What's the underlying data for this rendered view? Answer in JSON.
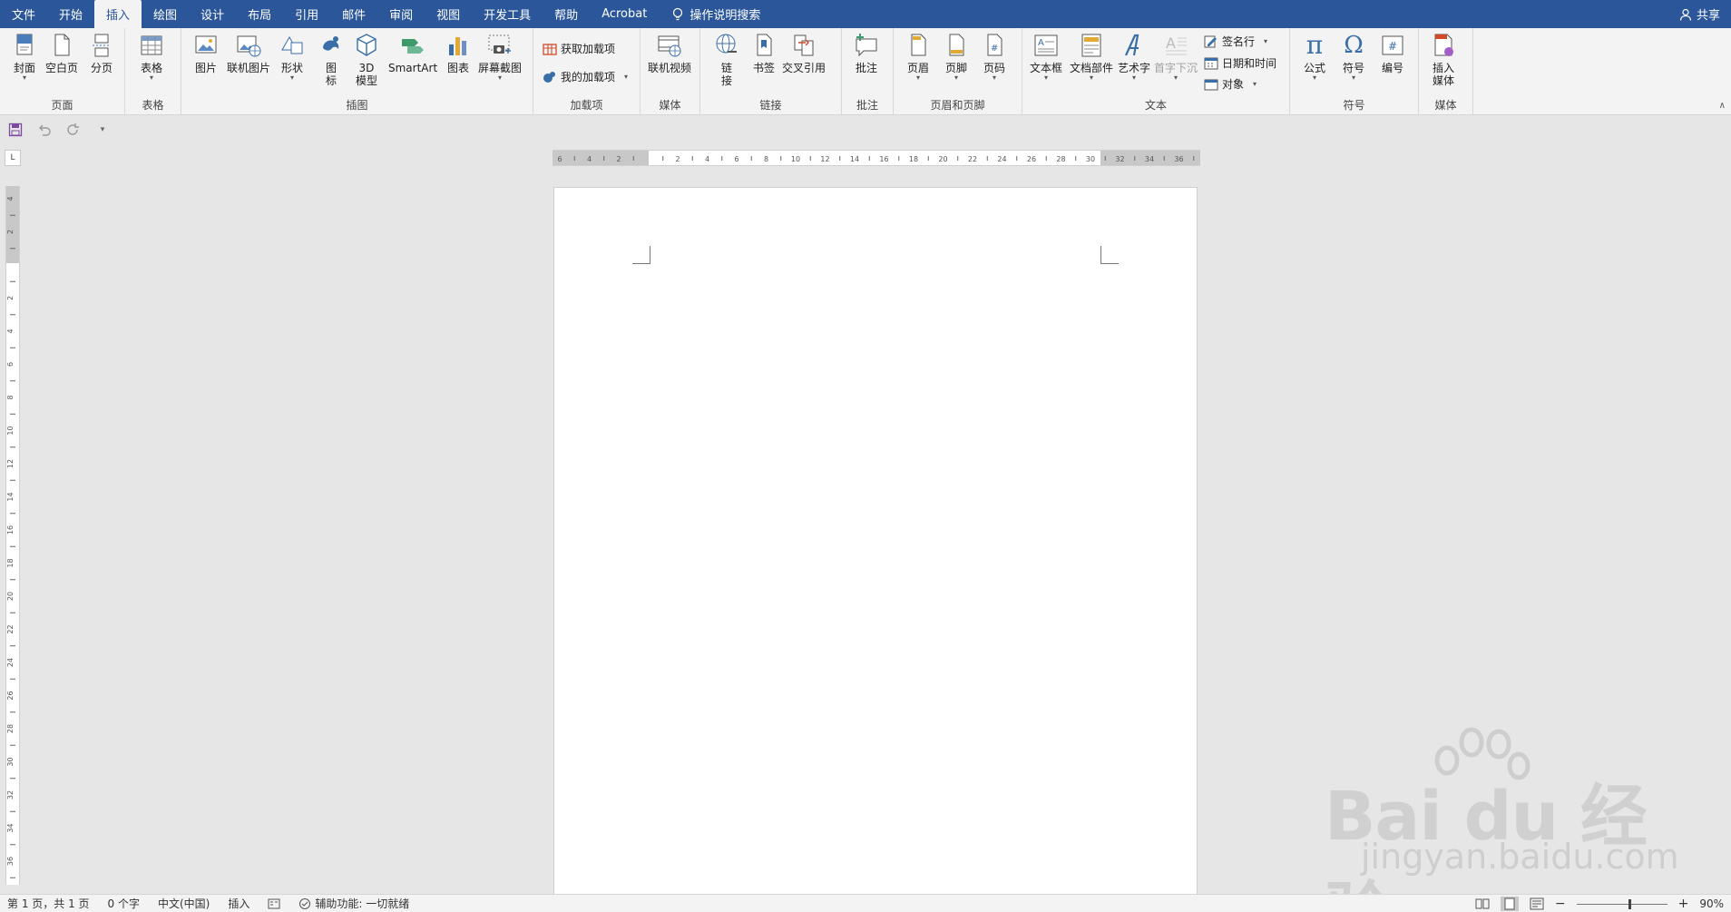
{
  "menubar": {
    "tabs": [
      "文件",
      "开始",
      "插入",
      "绘图",
      "设计",
      "布局",
      "引用",
      "邮件",
      "审阅",
      "视图",
      "开发工具",
      "帮助",
      "Acrobat"
    ],
    "active_tab": "插入",
    "search_label": "操作说明搜索",
    "share_label": "共享"
  },
  "ribbon": {
    "groups": {
      "pages": {
        "label": "页面",
        "buttons": [
          "封面",
          "空白页",
          "分页"
        ]
      },
      "tables": {
        "label": "表格",
        "buttons": [
          "表格"
        ]
      },
      "illustrations": {
        "label": "插图",
        "buttons": [
          "图片",
          "联机图片",
          "形状",
          "图\n标",
          "3D\n模型",
          "SmartArt",
          "图表",
          "屏幕截图"
        ]
      },
      "addins": {
        "label": "加载项",
        "buttons": [
          "获取加载项",
          "我的加载项"
        ]
      },
      "media1": {
        "label": "媒体",
        "buttons": [
          "联机视频"
        ]
      },
      "links": {
        "label": "链接",
        "buttons": [
          "链\n接",
          "书签",
          "交叉引用"
        ]
      },
      "comments": {
        "label": "批注",
        "buttons": [
          "批注"
        ]
      },
      "headerfooter": {
        "label": "页眉和页脚",
        "buttons": [
          "页眉",
          "页脚",
          "页码"
        ]
      },
      "text": {
        "label": "文本",
        "buttons": [
          "文本框",
          "文档部件",
          "艺术字",
          "首字下沉"
        ],
        "small": [
          "签名行",
          "日期和时间",
          "对象"
        ]
      },
      "symbols": {
        "label": "符号",
        "buttons": [
          "公式",
          "符号",
          "编号"
        ]
      },
      "media2": {
        "label": "媒体",
        "buttons": [
          "插入\n媒体"
        ]
      }
    }
  },
  "ruler": {
    "h_labels": [
      "6",
      "4",
      "2",
      "",
      "2",
      "4",
      "6",
      "8",
      "10",
      "12",
      "14",
      "16",
      "18",
      "20",
      "22",
      "24",
      "26",
      "28",
      "30",
      "32",
      "34",
      "36"
    ],
    "v_labels": [
      "4",
      "2",
      "",
      "2",
      "4",
      "6",
      "8",
      "10",
      "12",
      "14",
      "16",
      "18",
      "20",
      "22",
      "24",
      "26",
      "28",
      "30",
      "32",
      "34",
      "36"
    ]
  },
  "statusbar": {
    "page": "第 1 页，共 1 页",
    "words": "0 个字",
    "language": "中文(中国)",
    "mode": "插入",
    "accessibility": "辅助功能: 一切就绪",
    "zoom": "90%"
  },
  "watermark": {
    "main": "Bai du 经验",
    "sub": "jingyan.baidu.com"
  },
  "colors": {
    "accent": "#2b579a",
    "ribbon_bg": "#f3f3f3",
    "canvas_bg": "#e6e6e6"
  }
}
